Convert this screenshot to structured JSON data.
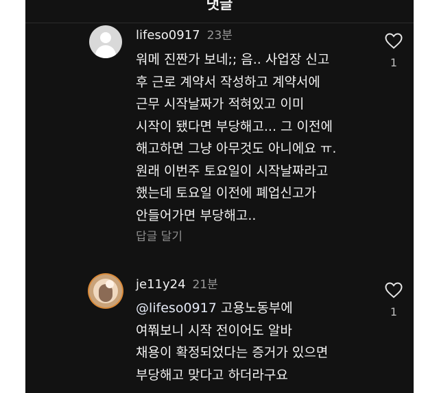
{
  "header": {
    "title": "댓글"
  },
  "comments": [
    {
      "username": "lifeso0917",
      "time": "23분",
      "lines": [
        "워메 진짠가 보네;; 음.. 사업장 신고",
        "후 근로 계약서 작성하고 계약서에",
        "근무 시작날짜가 적혀있고 이미",
        "시작이 됐다면 부당해고... 그 이전에",
        "해고하면 그냥 아무것도 아니에요 ㅠ.",
        "원래 이번주 토요일이 시작날짜라고",
        "했는데 토요일 이전에 폐업신고가",
        "안들어가면 부당해고.."
      ],
      "reply_label": "답글 달기",
      "likes": "1",
      "avatar_icon": "default-profile-icon"
    },
    {
      "username": "je11y24",
      "time": "21분",
      "mention": "@lifeso0917",
      "lines": [
        "고용노동부에",
        "여쭤보니 시작 전이어도 알바",
        "채용이 확정되었다는 증거가 있으면",
        "부당해고 맞다고 하더라구요"
      ],
      "likes": "1",
      "avatar_icon": "profile-photo"
    }
  ],
  "colors": {
    "background": "#121212",
    "text": "#f2f2f2",
    "secondary": "#9a9a9a",
    "accent_ring": "#d98a3a"
  },
  "icons": {
    "like": "heart-outline-icon"
  }
}
